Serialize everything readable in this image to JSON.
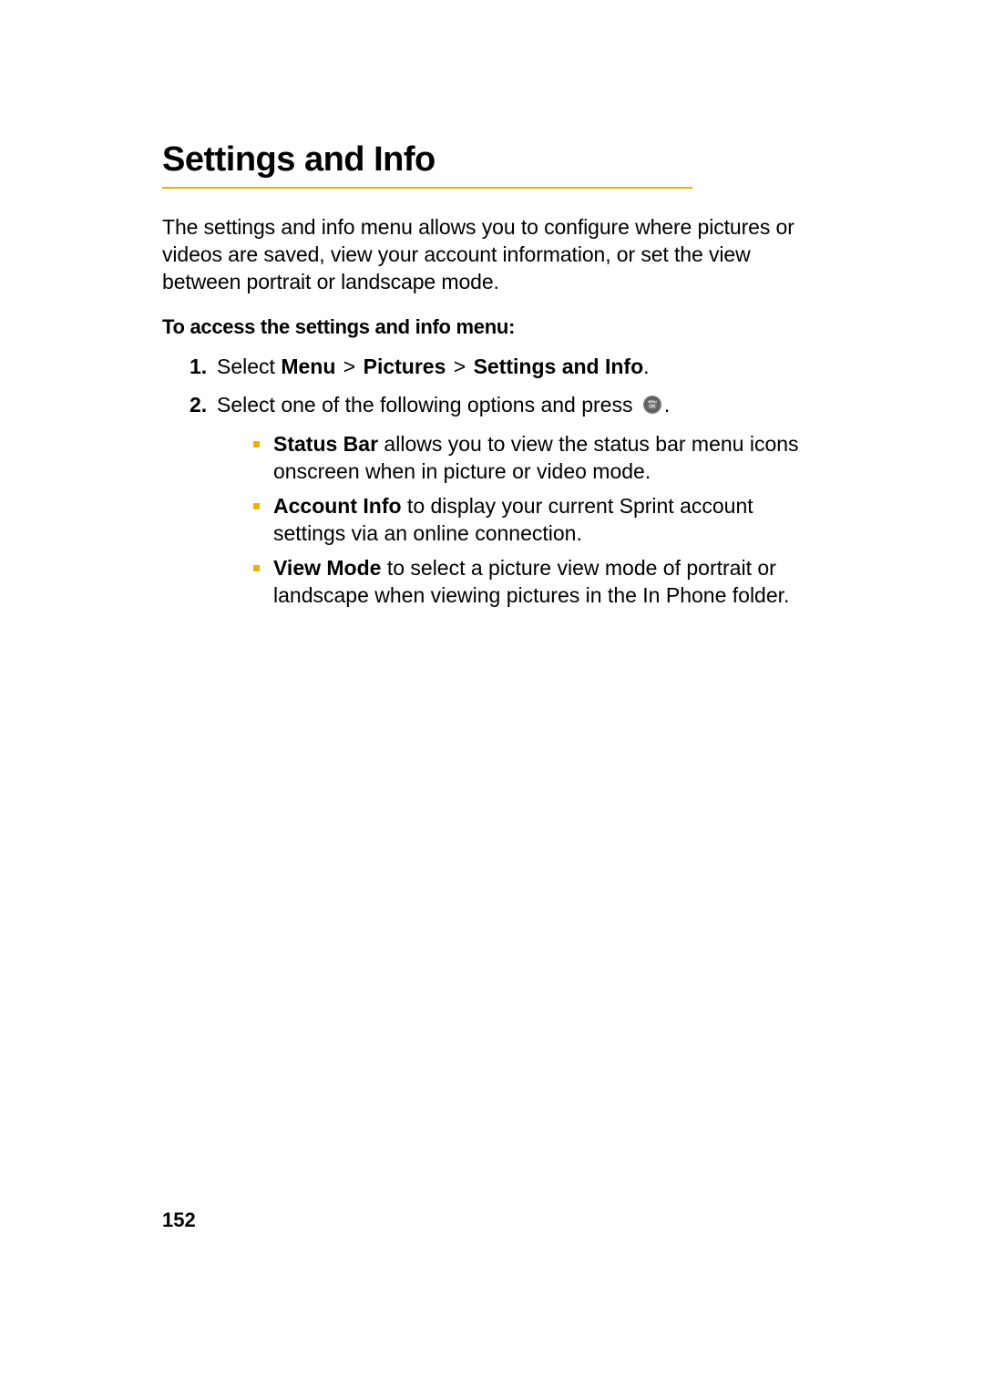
{
  "heading": "Settings and Info",
  "intro": "The settings and info menu allows you to configure where pictures or videos are saved, view your account information, or set the view between portrait or landscape mode.",
  "subhead": "To access the settings and info menu:",
  "step1_prefix": "Select ",
  "step1_menu": "Menu",
  "step1_pictures": "Pictures",
  "step1_settings": "Settings and Info",
  "gt": ">",
  "step1_suffix": ".",
  "step2_text": "Select one of the following options and press ",
  "step2_suffix": ".",
  "ok_label": "MENU OK",
  "bullets": [
    {
      "bold": "Status Bar",
      "rest": " allows you to view the status bar menu icons onscreen when in picture or video mode."
    },
    {
      "bold": "Account Info",
      "rest": " to display your current Sprint account settings via an online connection."
    },
    {
      "bold": "View Mode",
      "rest": " to select a picture view mode of portrait or landscape when viewing pictures in the In Phone folder."
    }
  ],
  "page_number": "152",
  "colors": {
    "accent": "#f0b000"
  }
}
